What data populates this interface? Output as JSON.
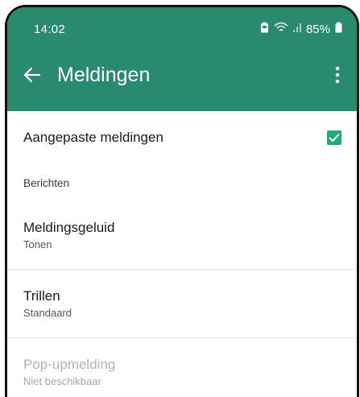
{
  "status_bar": {
    "time": "14:02",
    "battery": "85%"
  },
  "app_bar": {
    "title": "Meldingen"
  },
  "custom_notifications": {
    "label": "Aangepaste meldingen",
    "checked": true
  },
  "section": {
    "header": "Berichten"
  },
  "settings": [
    {
      "title": "Meldingsgeluid",
      "value": "Tonen",
      "enabled": true
    },
    {
      "title": "Trillen",
      "value": "Standaard",
      "enabled": true
    },
    {
      "title": "Pop-upmelding",
      "value": "Niet beschikbaar",
      "enabled": false
    }
  ],
  "colors": {
    "header_background": "#2a8a6e",
    "checkbox": "#1fa97c",
    "text_primary": "#1a1a1a",
    "text_disabled": "#b3b3b3"
  },
  "icons": {
    "back": "arrow-left-icon",
    "more": "more-vertical-icon",
    "battery_saver": "battery-saver-icon",
    "wifi": "wifi-icon",
    "signal": "signal-icon",
    "battery": "battery-icon"
  }
}
